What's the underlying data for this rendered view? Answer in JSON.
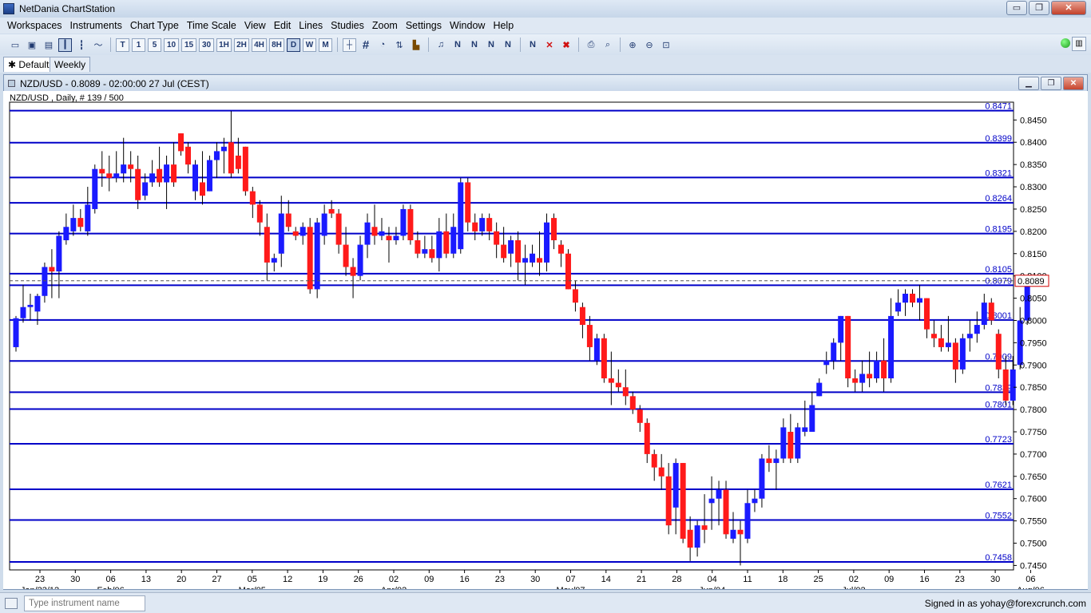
{
  "app": {
    "title": "NetDania ChartStation",
    "window_buttons": {
      "minimize": "▭",
      "restore": "❐",
      "close": "✕"
    }
  },
  "menu": [
    "Workspaces",
    "Instruments",
    "Chart Type",
    "Time Scale",
    "View",
    "Edit",
    "Lines",
    "Studies",
    "Zoom",
    "Settings",
    "Window",
    "Help"
  ],
  "toolbar": {
    "timeframes": [
      "T",
      "1",
      "5",
      "10",
      "15",
      "30",
      "1H",
      "2H",
      "4H",
      "8H",
      "D",
      "W",
      "M"
    ],
    "active_timeframe": "D",
    "icons": [
      "new-icon",
      "save-icon",
      "print-icon",
      "candle-icon",
      "bar-icon",
      "line-icon",
      "crosshair-icon",
      "grid-icon",
      "study-icon",
      "volume-icon",
      "alert-icon",
      "trendline-icon",
      "fib-icon",
      "delete-icon",
      "zoom-in-icon",
      "zoom-out-icon"
    ]
  },
  "tabs": [
    {
      "label": "Default",
      "active": true
    },
    {
      "label": "Weekly",
      "active": false
    }
  ],
  "chart_window": {
    "title": "NZD/USD - 0.8089 - 02:00:00  27 Jul (CEST)",
    "info": "NZD/USD , Daily, # 139 / 500"
  },
  "chart_data": {
    "type": "candlestick",
    "symbol": "NZD/USD",
    "timeframe": "Daily",
    "last_price": "0.8089",
    "ylim": [
      0.744,
      0.849
    ],
    "y_ticks": [
      "0.8450",
      "0.8400",
      "0.8350",
      "0.8300",
      "0.8250",
      "0.8200",
      "0.8150",
      "0.8100",
      "0.8050",
      "0.8000",
      "0.7950",
      "0.7900",
      "0.7850",
      "0.7800",
      "0.7750",
      "0.7700",
      "0.7650",
      "0.7600",
      "0.7550",
      "0.7500",
      "0.7450"
    ],
    "x_day_labels": [
      "23",
      "30",
      "06",
      "13",
      "20",
      "27",
      "05",
      "12",
      "19",
      "26",
      "02",
      "09",
      "16",
      "23",
      "30",
      "07",
      "14",
      "21",
      "28",
      "04",
      "11",
      "18",
      "25",
      "02",
      "09",
      "16",
      "23",
      "30",
      "06"
    ],
    "x_month_labels": [
      "Jan/23/12",
      "Feb/06",
      "Mar/05",
      "Apr/02",
      "May/07",
      "Jun/04",
      "Jul/02",
      "Aug/06"
    ],
    "levels": [
      0.8471,
      0.8399,
      0.8321,
      0.8264,
      0.8195,
      0.8105,
      0.8079,
      0.8001,
      0.7909,
      0.7839,
      0.7801,
      0.7723,
      0.7621,
      0.7552,
      0.7458
    ],
    "level_labels": [
      "0.8471",
      "0.8399",
      "0.8321",
      "0.8264",
      "0.8195",
      "0.8105",
      "0.8079",
      "0.8001",
      "0.7909",
      "0.7839",
      "0.7801",
      "0.7723",
      "0.7621",
      "0.7552",
      "0.7458"
    ],
    "candles": [
      {
        "o": 0.794,
        "h": 0.801,
        "l": 0.793,
        "c": 0.8005
      },
      {
        "o": 0.8005,
        "h": 0.808,
        "l": 0.7995,
        "c": 0.803
      },
      {
        "o": 0.803,
        "h": 0.806,
        "l": 0.8,
        "c": 0.8035
      },
      {
        "o": 0.802,
        "h": 0.806,
        "l": 0.799,
        "c": 0.8055
      },
      {
        "o": 0.8055,
        "h": 0.813,
        "l": 0.804,
        "c": 0.812
      },
      {
        "o": 0.812,
        "h": 0.816,
        "l": 0.805,
        "c": 0.811
      },
      {
        "o": 0.811,
        "h": 0.82,
        "l": 0.805,
        "c": 0.819
      },
      {
        "o": 0.818,
        "h": 0.824,
        "l": 0.817,
        "c": 0.821
      },
      {
        "o": 0.82,
        "h": 0.826,
        "l": 0.819,
        "c": 0.823
      },
      {
        "o": 0.823,
        "h": 0.825,
        "l": 0.82,
        "c": 0.821
      },
      {
        "o": 0.82,
        "h": 0.83,
        "l": 0.819,
        "c": 0.826
      },
      {
        "o": 0.825,
        "h": 0.835,
        "l": 0.824,
        "c": 0.834
      },
      {
        "o": 0.834,
        "h": 0.838,
        "l": 0.83,
        "c": 0.833
      },
      {
        "o": 0.833,
        "h": 0.837,
        "l": 0.829,
        "c": 0.832
      },
      {
        "o": 0.832,
        "h": 0.838,
        "l": 0.831,
        "c": 0.833
      },
      {
        "o": 0.833,
        "h": 0.841,
        "l": 0.831,
        "c": 0.835
      },
      {
        "o": 0.835,
        "h": 0.838,
        "l": 0.831,
        "c": 0.834
      },
      {
        "o": 0.834,
        "h": 0.837,
        "l": 0.825,
        "c": 0.827
      },
      {
        "o": 0.828,
        "h": 0.833,
        "l": 0.827,
        "c": 0.831
      },
      {
        "o": 0.831,
        "h": 0.836,
        "l": 0.83,
        "c": 0.833
      },
      {
        "o": 0.834,
        "h": 0.839,
        "l": 0.83,
        "c": 0.831
      },
      {
        "o": 0.831,
        "h": 0.837,
        "l": 0.825,
        "c": 0.835
      },
      {
        "o": 0.835,
        "h": 0.84,
        "l": 0.83,
        "c": 0.831
      },
      {
        "o": 0.842,
        "h": 0.842,
        "l": 0.837,
        "c": 0.838
      },
      {
        "o": 0.839,
        "h": 0.84,
        "l": 0.833,
        "c": 0.835
      },
      {
        "o": 0.829,
        "h": 0.836,
        "l": 0.827,
        "c": 0.835
      },
      {
        "o": 0.831,
        "h": 0.838,
        "l": 0.826,
        "c": 0.828
      },
      {
        "o": 0.829,
        "h": 0.837,
        "l": 0.829,
        "c": 0.836
      },
      {
        "o": 0.836,
        "h": 0.84,
        "l": 0.832,
        "c": 0.838
      },
      {
        "o": 0.838,
        "h": 0.841,
        "l": 0.833,
        "c": 0.839
      },
      {
        "o": 0.84,
        "h": 0.847,
        "l": 0.832,
        "c": 0.833
      },
      {
        "o": 0.837,
        "h": 0.841,
        "l": 0.833,
        "c": 0.834
      },
      {
        "o": 0.839,
        "h": 0.839,
        "l": 0.828,
        "c": 0.829
      },
      {
        "o": 0.829,
        "h": 0.83,
        "l": 0.823,
        "c": 0.826
      },
      {
        "o": 0.826,
        "h": 0.827,
        "l": 0.819,
        "c": 0.822
      },
      {
        "o": 0.821,
        "h": 0.824,
        "l": 0.809,
        "c": 0.813
      },
      {
        "o": 0.813,
        "h": 0.815,
        "l": 0.811,
        "c": 0.814
      },
      {
        "o": 0.815,
        "h": 0.828,
        "l": 0.812,
        "c": 0.824
      },
      {
        "o": 0.824,
        "h": 0.827,
        "l": 0.82,
        "c": 0.821
      },
      {
        "o": 0.82,
        "h": 0.821,
        "l": 0.818,
        "c": 0.819
      },
      {
        "o": 0.819,
        "h": 0.822,
        "l": 0.817,
        "c": 0.821
      },
      {
        "o": 0.821,
        "h": 0.823,
        "l": 0.806,
        "c": 0.807
      },
      {
        "o": 0.807,
        "h": 0.823,
        "l": 0.805,
        "c": 0.822
      },
      {
        "o": 0.819,
        "h": 0.826,
        "l": 0.817,
        "c": 0.824
      },
      {
        "o": 0.825,
        "h": 0.827,
        "l": 0.823,
        "c": 0.824
      },
      {
        "o": 0.824,
        "h": 0.825,
        "l": 0.815,
        "c": 0.817
      },
      {
        "o": 0.817,
        "h": 0.821,
        "l": 0.81,
        "c": 0.812
      },
      {
        "o": 0.812,
        "h": 0.814,
        "l": 0.805,
        "c": 0.81
      },
      {
        "o": 0.81,
        "h": 0.819,
        "l": 0.809,
        "c": 0.817
      },
      {
        "o": 0.817,
        "h": 0.824,
        "l": 0.814,
        "c": 0.822
      },
      {
        "o": 0.821,
        "h": 0.826,
        "l": 0.817,
        "c": 0.819
      },
      {
        "o": 0.819,
        "h": 0.823,
        "l": 0.818,
        "c": 0.82
      },
      {
        "o": 0.819,
        "h": 0.821,
        "l": 0.813,
        "c": 0.818
      },
      {
        "o": 0.818,
        "h": 0.821,
        "l": 0.817,
        "c": 0.819
      },
      {
        "o": 0.819,
        "h": 0.826,
        "l": 0.818,
        "c": 0.825
      },
      {
        "o": 0.825,
        "h": 0.826,
        "l": 0.817,
        "c": 0.818
      },
      {
        "o": 0.818,
        "h": 0.82,
        "l": 0.814,
        "c": 0.815
      },
      {
        "o": 0.815,
        "h": 0.819,
        "l": 0.814,
        "c": 0.816
      },
      {
        "o": 0.816,
        "h": 0.819,
        "l": 0.813,
        "c": 0.814
      },
      {
        "o": 0.814,
        "h": 0.823,
        "l": 0.811,
        "c": 0.82
      },
      {
        "o": 0.82,
        "h": 0.824,
        "l": 0.814,
        "c": 0.815
      },
      {
        "o": 0.815,
        "h": 0.824,
        "l": 0.814,
        "c": 0.821
      },
      {
        "o": 0.816,
        "h": 0.832,
        "l": 0.815,
        "c": 0.831
      },
      {
        "o": 0.831,
        "h": 0.832,
        "l": 0.82,
        "c": 0.822
      },
      {
        "o": 0.822,
        "h": 0.824,
        "l": 0.818,
        "c": 0.82
      },
      {
        "o": 0.82,
        "h": 0.824,
        "l": 0.819,
        "c": 0.823
      },
      {
        "o": 0.823,
        "h": 0.824,
        "l": 0.818,
        "c": 0.82
      },
      {
        "o": 0.82,
        "h": 0.822,
        "l": 0.814,
        "c": 0.817
      },
      {
        "o": 0.817,
        "h": 0.821,
        "l": 0.813,
        "c": 0.814
      },
      {
        "o": 0.815,
        "h": 0.819,
        "l": 0.812,
        "c": 0.818
      },
      {
        "o": 0.818,
        "h": 0.82,
        "l": 0.809,
        "c": 0.813
      },
      {
        "o": 0.813,
        "h": 0.817,
        "l": 0.808,
        "c": 0.814
      },
      {
        "o": 0.813,
        "h": 0.817,
        "l": 0.812,
        "c": 0.815
      },
      {
        "o": 0.814,
        "h": 0.82,
        "l": 0.81,
        "c": 0.813
      },
      {
        "o": 0.813,
        "h": 0.824,
        "l": 0.811,
        "c": 0.822
      },
      {
        "o": 0.823,
        "h": 0.824,
        "l": 0.816,
        "c": 0.818
      },
      {
        "o": 0.817,
        "h": 0.818,
        "l": 0.812,
        "c": 0.815
      },
      {
        "o": 0.815,
        "h": 0.816,
        "l": 0.807,
        "c": 0.807
      },
      {
        "o": 0.807,
        "h": 0.809,
        "l": 0.802,
        "c": 0.804
      },
      {
        "o": 0.803,
        "h": 0.804,
        "l": 0.796,
        "c": 0.799
      },
      {
        "o": 0.799,
        "h": 0.801,
        "l": 0.791,
        "c": 0.794
      },
      {
        "o": 0.791,
        "h": 0.797,
        "l": 0.79,
        "c": 0.796
      },
      {
        "o": 0.796,
        "h": 0.797,
        "l": 0.786,
        "c": 0.787
      },
      {
        "o": 0.787,
        "h": 0.793,
        "l": 0.781,
        "c": 0.786
      },
      {
        "o": 0.786,
        "h": 0.789,
        "l": 0.784,
        "c": 0.785
      },
      {
        "o": 0.785,
        "h": 0.789,
        "l": 0.781,
        "c": 0.783
      },
      {
        "o": 0.783,
        "h": 0.784,
        "l": 0.779,
        "c": 0.78
      },
      {
        "o": 0.78,
        "h": 0.781,
        "l": 0.775,
        "c": 0.777
      },
      {
        "o": 0.777,
        "h": 0.778,
        "l": 0.768,
        "c": 0.77
      },
      {
        "o": 0.77,
        "h": 0.771,
        "l": 0.764,
        "c": 0.767
      },
      {
        "o": 0.767,
        "h": 0.77,
        "l": 0.762,
        "c": 0.765
      },
      {
        "o": 0.765,
        "h": 0.768,
        "l": 0.752,
        "c": 0.754
      },
      {
        "o": 0.758,
        "h": 0.769,
        "l": 0.752,
        "c": 0.768
      },
      {
        "o": 0.768,
        "h": 0.768,
        "l": 0.75,
        "c": 0.751
      },
      {
        "o": 0.753,
        "h": 0.756,
        "l": 0.746,
        "c": 0.749
      },
      {
        "o": 0.749,
        "h": 0.755,
        "l": 0.747,
        "c": 0.754
      },
      {
        "o": 0.754,
        "h": 0.761,
        "l": 0.75,
        "c": 0.753
      },
      {
        "o": 0.759,
        "h": 0.765,
        "l": 0.753,
        "c": 0.76
      },
      {
        "o": 0.76,
        "h": 0.764,
        "l": 0.754,
        "c": 0.762
      },
      {
        "o": 0.762,
        "h": 0.764,
        "l": 0.751,
        "c": 0.752
      },
      {
        "o": 0.751,
        "h": 0.757,
        "l": 0.75,
        "c": 0.753
      },
      {
        "o": 0.753,
        "h": 0.755,
        "l": 0.745,
        "c": 0.752
      },
      {
        "o": 0.751,
        "h": 0.762,
        "l": 0.75,
        "c": 0.759
      },
      {
        "o": 0.759,
        "h": 0.762,
        "l": 0.757,
        "c": 0.76
      },
      {
        "o": 0.76,
        "h": 0.77,
        "l": 0.758,
        "c": 0.769
      },
      {
        "o": 0.769,
        "h": 0.772,
        "l": 0.766,
        "c": 0.768
      },
      {
        "o": 0.768,
        "h": 0.771,
        "l": 0.762,
        "c": 0.769
      },
      {
        "o": 0.769,
        "h": 0.778,
        "l": 0.768,
        "c": 0.776
      },
      {
        "o": 0.775,
        "h": 0.779,
        "l": 0.768,
        "c": 0.769
      },
      {
        "o": 0.769,
        "h": 0.777,
        "l": 0.768,
        "c": 0.776
      },
      {
        "o": 0.775,
        "h": 0.782,
        "l": 0.774,
        "c": 0.776
      },
      {
        "o": 0.775,
        "h": 0.784,
        "l": 0.775,
        "c": 0.781
      },
      {
        "o": 0.783,
        "h": 0.787,
        "l": 0.783,
        "c": 0.786
      },
      {
        "o": 0.79,
        "h": 0.793,
        "l": 0.788,
        "c": 0.791
      },
      {
        "o": 0.791,
        "h": 0.796,
        "l": 0.789,
        "c": 0.795
      },
      {
        "o": 0.795,
        "h": 0.801,
        "l": 0.791,
        "c": 0.801
      },
      {
        "o": 0.801,
        "h": 0.801,
        "l": 0.785,
        "c": 0.787
      },
      {
        "o": 0.787,
        "h": 0.789,
        "l": 0.784,
        "c": 0.786
      },
      {
        "o": 0.786,
        "h": 0.791,
        "l": 0.784,
        "c": 0.788
      },
      {
        "o": 0.788,
        "h": 0.793,
        "l": 0.785,
        "c": 0.787
      },
      {
        "o": 0.787,
        "h": 0.793,
        "l": 0.786,
        "c": 0.791
      },
      {
        "o": 0.791,
        "h": 0.796,
        "l": 0.784,
        "c": 0.787
      },
      {
        "o": 0.787,
        "h": 0.805,
        "l": 0.786,
        "c": 0.801
      },
      {
        "o": 0.802,
        "h": 0.807,
        "l": 0.801,
        "c": 0.804
      },
      {
        "o": 0.804,
        "h": 0.807,
        "l": 0.801,
        "c": 0.806
      },
      {
        "o": 0.806,
        "h": 0.807,
        "l": 0.803,
        "c": 0.804
      },
      {
        "o": 0.804,
        "h": 0.808,
        "l": 0.8,
        "c": 0.805
      },
      {
        "o": 0.805,
        "h": 0.805,
        "l": 0.796,
        "c": 0.798
      },
      {
        "o": 0.797,
        "h": 0.8,
        "l": 0.794,
        "c": 0.796
      },
      {
        "o": 0.796,
        "h": 0.799,
        "l": 0.793,
        "c": 0.794
      },
      {
        "o": 0.794,
        "h": 0.801,
        "l": 0.793,
        "c": 0.795
      },
      {
        "o": 0.795,
        "h": 0.796,
        "l": 0.786,
        "c": 0.789
      },
      {
        "o": 0.789,
        "h": 0.797,
        "l": 0.788,
        "c": 0.796
      },
      {
        "o": 0.796,
        "h": 0.8,
        "l": 0.793,
        "c": 0.797
      },
      {
        "o": 0.797,
        "h": 0.802,
        "l": 0.795,
        "c": 0.799
      },
      {
        "o": 0.799,
        "h": 0.806,
        "l": 0.798,
        "c": 0.804
      },
      {
        "o": 0.804,
        "h": 0.805,
        "l": 0.799,
        "c": 0.8
      },
      {
        "o": 0.797,
        "h": 0.798,
        "l": 0.787,
        "c": 0.789
      },
      {
        "o": 0.789,
        "h": 0.792,
        "l": 0.781,
        "c": 0.782
      },
      {
        "o": 0.782,
        "h": 0.792,
        "l": 0.781,
        "c": 0.789
      },
      {
        "o": 0.79,
        "h": 0.803,
        "l": 0.789,
        "c": 0.8
      },
      {
        "o": 0.8,
        "h": 0.81,
        "l": 0.799,
        "c": 0.8089
      }
    ]
  },
  "statusbar": {
    "instrument_placeholder": "Type instrument name",
    "signed_in": "Signed in as yohay@forexcrunch.com"
  }
}
